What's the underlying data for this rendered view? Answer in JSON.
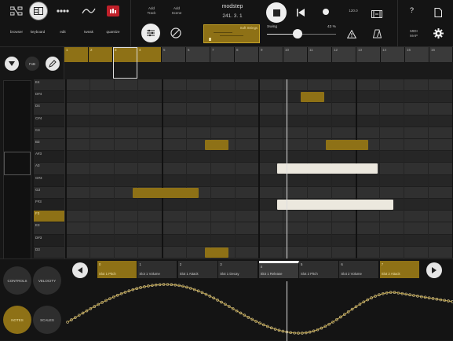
{
  "toolbar": {
    "items": [
      {
        "label": "browser",
        "icon": "browser-icon"
      },
      {
        "label": "keyboard",
        "icon": "keyboard-icon"
      },
      {
        "label": "edit",
        "icon": "edit-icon"
      },
      {
        "label": "tweak",
        "icon": "tweak-icon"
      },
      {
        "label": "quantize",
        "icon": "quantize-icon"
      }
    ],
    "add_track": "Add\nTrack",
    "add_scene": "Add\nScene",
    "app_name": "modstep",
    "position": "241. 3. 1",
    "clip_name": "Soft Strings",
    "swing_label": "Swing",
    "swing_value": "43 %",
    "tempo": "120.0",
    "midi_map": "MIDI\nMAP",
    "help": "?"
  },
  "clip_strip": {
    "numbers": [
      "1",
      "2",
      "3",
      "4",
      "5",
      "6",
      "7",
      "8",
      "9",
      "10",
      "11",
      "12",
      "13",
      "14",
      "15",
      "16"
    ]
  },
  "left_panel": {
    "fx_label": "FxB"
  },
  "piano_keys": [
    "E4",
    "D#4",
    "D4",
    "C#4",
    "C4",
    "B3",
    "A#3",
    "A3",
    "G#3",
    "G3",
    "F#3",
    "F3",
    "E3",
    "D#3",
    "D3",
    "C#3"
  ],
  "modes": {
    "controls": "CONTROLS",
    "velocity": "VELOCITY",
    "notes": "NOTES",
    "scales": "SCALES"
  },
  "slots": [
    {
      "num": "0",
      "name": "Slot 1 Pitch"
    },
    {
      "num": "1",
      "name": "Slot 1 Volume"
    },
    {
      "num": "2",
      "name": "Slot 1 Attack"
    },
    {
      "num": "3",
      "name": "Slot 1 Decay"
    },
    {
      "num": "4",
      "name": "Slot 1 Release"
    },
    {
      "num": "5",
      "name": "Slot 2 Pitch"
    },
    {
      "num": "6",
      "name": "Slot 2 Volume"
    },
    {
      "num": "7",
      "name": "Slot 2 Attack"
    }
  ],
  "colors": {
    "accent": "#8e7116",
    "note_selected": "#ece8de",
    "background": "#1a1a1a"
  }
}
